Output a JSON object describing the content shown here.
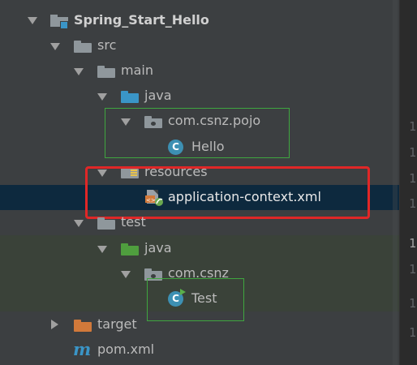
{
  "tree": {
    "project": {
      "label": "Spring_Start_Hello"
    },
    "src": {
      "label": "src"
    },
    "main": {
      "label": "main"
    },
    "main_java": {
      "label": "java"
    },
    "pojo_package": {
      "label": "com.csnz.pojo"
    },
    "hello_class": {
      "label": "Hello",
      "icon_letter": "C"
    },
    "resources": {
      "label": "resources"
    },
    "app_context": {
      "label": "application-context.xml"
    },
    "test": {
      "label": "test"
    },
    "test_java": {
      "label": "java"
    },
    "csnz_package": {
      "label": "com.csnz"
    },
    "test_class": {
      "label": "Test",
      "icon_letter": "C"
    },
    "target": {
      "label": "target"
    },
    "pom": {
      "label": "pom.xml",
      "icon_letter": "m"
    }
  },
  "gutter": {
    "line_numbers": [
      "1",
      "1",
      "1",
      "1",
      "1",
      "1",
      "1",
      "1"
    ]
  },
  "colors": {
    "background": "#3c3f41",
    "selection": "#0d293e",
    "test_highlight": "#3a4239",
    "annotation_green": "#3fa63f",
    "annotation_red": "#e02727",
    "folder_blue": "#3a95c7",
    "folder_green": "#4f9e3e",
    "folder_orange": "#d1793a"
  }
}
